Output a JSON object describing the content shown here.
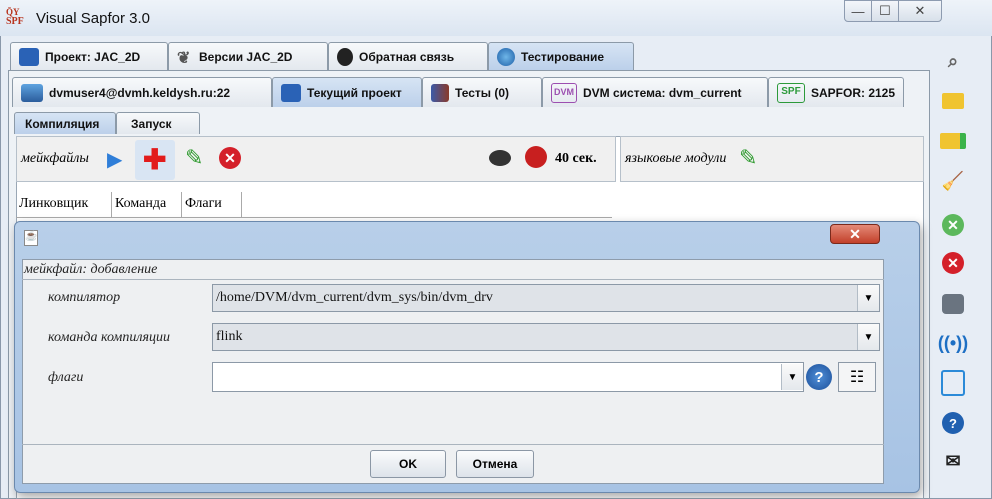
{
  "window": {
    "title": "Visual Sapfor 3.0",
    "app_icon_text": "SPF"
  },
  "main_tabs": [
    {
      "label": "Проект: JAC_2D"
    },
    {
      "label": "Версии JAC_2D"
    },
    {
      "label": "Обратная связь"
    },
    {
      "label": "Тестирование"
    }
  ],
  "testing_tabs": [
    {
      "label": "dvmuser4@dvmh.keldysh.ru:22"
    },
    {
      "label": "Текущий проект"
    },
    {
      "label": "Тесты (0)"
    },
    {
      "label": "DVM система: dvm_current",
      "badge": "DVM"
    },
    {
      "label": "SAPFOR: 2125",
      "badge": "SPF"
    }
  ],
  "sub_tabs": [
    {
      "label": "Компиляция"
    },
    {
      "label": "Запуск"
    }
  ],
  "makefiles_toolbar": {
    "label": "мейкфайлы",
    "timer": "40 сек."
  },
  "modules_toolbar": {
    "label": "языковые модули"
  },
  "table": {
    "columns": [
      "Линковщик",
      "Команда",
      "Флаги"
    ]
  },
  "dialog": {
    "heading": "мейкфайл: добавление",
    "compiler_label": "компилятор",
    "compiler_value": "/home/DVM/dvm_current/dvm_sys/bin/dvm_drv",
    "command_label": "команда компиляции",
    "command_value": "flink",
    "flags_label": "флаги",
    "flags_value": "",
    "ok": "OK",
    "cancel": "Отмена"
  }
}
